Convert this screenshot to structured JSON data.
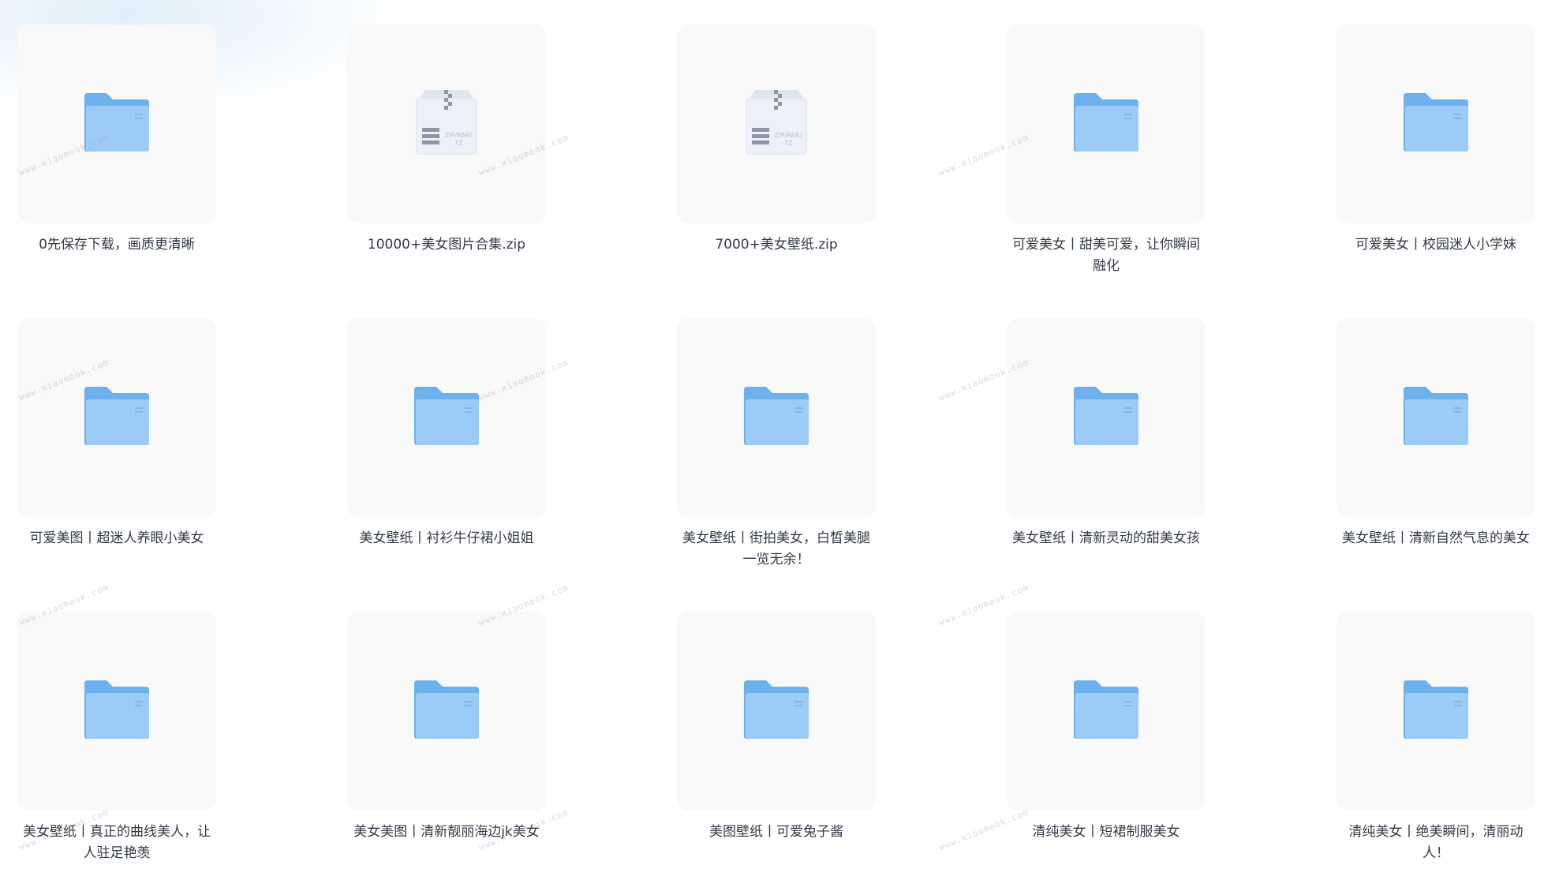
{
  "watermark_text": "www.xiaomook.com",
  "colors": {
    "folder_back": "#6cb0ee",
    "folder_front": "#9ccbf6",
    "zip_box": "#e6eaf2",
    "zip_stripes": "#8c96a8",
    "tile_bg": "#f9f9fa",
    "text": "#333a45"
  },
  "items": [
    {
      "name": "0先保存下载，画质更清晰",
      "icon": "folder-icon"
    },
    {
      "name": "10000+美女图片合集.zip",
      "icon": "zip-icon",
      "zip_label": "ZIP/RAR/\n7Z"
    },
    {
      "name": "7000+美女壁纸.zip",
      "icon": "zip-icon",
      "zip_label": "ZIP/RAR/\n7Z"
    },
    {
      "name": "可爱美女丨甜美可爱，让你瞬间融化",
      "icon": "folder-icon"
    },
    {
      "name": "可爱美女丨校园迷人小学妹",
      "icon": "folder-icon"
    },
    {
      "name": "可爱美图丨超迷人养眼小美女",
      "icon": "folder-icon"
    },
    {
      "name": "美女壁纸丨衬衫牛仔裙小姐姐",
      "icon": "folder-icon"
    },
    {
      "name": "美女壁纸丨街拍美女，白皙美腿一览无余！",
      "icon": "folder-icon"
    },
    {
      "name": "美女壁纸丨清新灵动的甜美女孩",
      "icon": "folder-icon"
    },
    {
      "name": "美女壁纸丨清新自然气息的美女",
      "icon": "folder-icon"
    },
    {
      "name": "美女壁纸丨真正的曲线美人，让人驻足艳羡",
      "icon": "folder-icon"
    },
    {
      "name": "美女美图丨清新靓丽海边jk美女",
      "icon": "folder-icon"
    },
    {
      "name": "美图壁纸丨可爱兔子酱",
      "icon": "folder-icon"
    },
    {
      "name": "清纯美女丨短裙制服美女",
      "icon": "folder-icon"
    },
    {
      "name": "清纯美女丨绝美瞬间，清丽动人！",
      "icon": "folder-icon"
    }
  ]
}
